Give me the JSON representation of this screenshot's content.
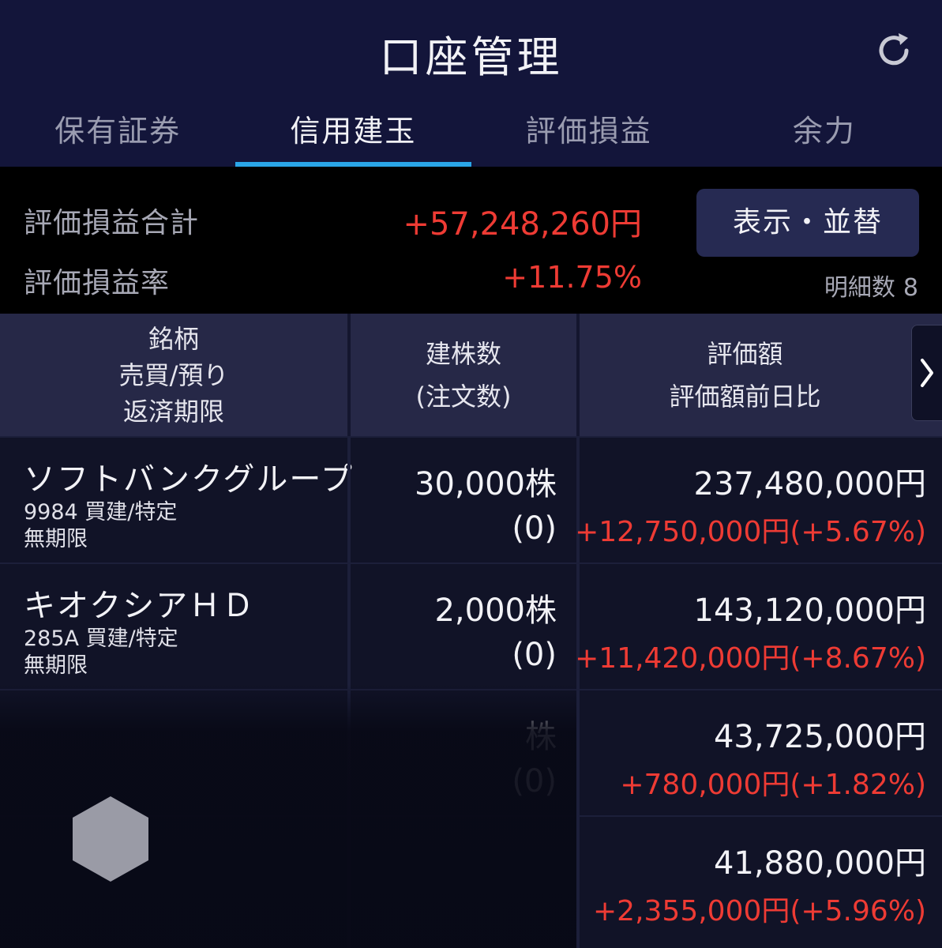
{
  "header": {
    "title": "口座管理"
  },
  "tabs": [
    {
      "label": "保有証券",
      "active": false
    },
    {
      "label": "信用建玉",
      "active": true
    },
    {
      "label": "評価損益",
      "active": false
    },
    {
      "label": "余力",
      "active": false
    }
  ],
  "summary": {
    "total_label": "評価損益合計",
    "total_value": "+57,248,260円",
    "rate_label": "評価損益率",
    "rate_value": "+11.75%",
    "sort_button": "表示・並替",
    "detail_label": "明細数",
    "detail_count": "8"
  },
  "columns": {
    "col1_line1": "銘柄",
    "col1_line2": "売買/預り",
    "col1_line3": "返済期限",
    "col2_line1": "建株数",
    "col2_line2": "(注文数)",
    "col3_line1": "評価額",
    "col3_line2": "評価額前日比"
  },
  "rows": [
    {
      "name": "ソフトバンクグループ",
      "sub": "9984 買建/特定",
      "expiry": "無期限",
      "qty": "30,000株",
      "orders": "(0)",
      "value": "237,480,000円",
      "change": "+12,750,000円(+5.67%)"
    },
    {
      "name": "キオクシアＨＤ",
      "sub": "285A 買建/特定",
      "expiry": "無期限",
      "qty": "2,000株",
      "orders": "(0)",
      "value": "143,120,000円",
      "change": "+11,420,000円(+8.67%)"
    },
    {
      "name": "",
      "sub": "",
      "expiry": "",
      "qty": "株",
      "orders": "(0)",
      "value": "43,725,000円",
      "change": "+780,000円(+1.82%)"
    },
    {
      "name": "",
      "sub": "",
      "expiry": "",
      "qty": "",
      "orders": "",
      "value": "41,880,000円",
      "change": "+2,355,000円(+5.96%)"
    }
  ],
  "colors": {
    "positive": "#ee3b34",
    "tab_indicator": "#2aa6e8",
    "header_bg": "#13153a"
  },
  "icons": {
    "refresh": "refresh-icon",
    "next": "chevron-right-icon"
  }
}
